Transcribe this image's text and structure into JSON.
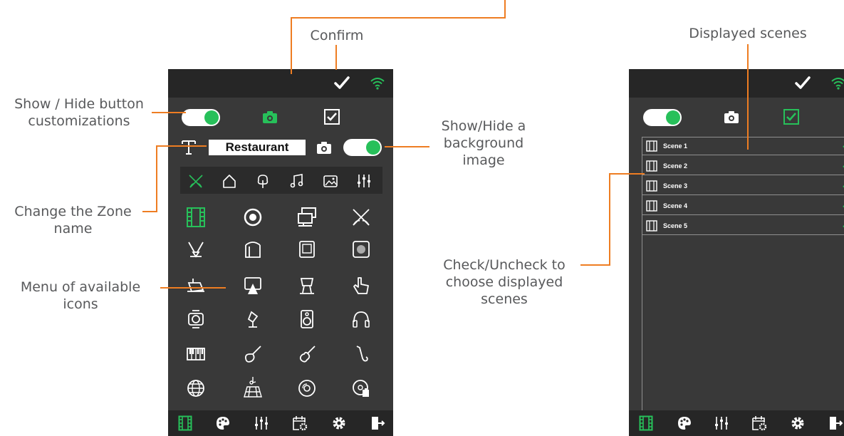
{
  "annotations": {
    "confirm": "Confirm",
    "show_hide_customizations": [
      "Show / Hide button",
      "customizations"
    ],
    "change_zone_name": [
      "Change the Zone",
      "name"
    ],
    "menu_icons": [
      "Menu of available",
      "icons"
    ],
    "show_hide_background": [
      "Show/Hide a",
      "background",
      "image"
    ],
    "displayed_scenes": "Displayed scenes",
    "check_uncheck": [
      "Check/Uncheck to",
      "choose displayed",
      "scenes"
    ]
  },
  "left_phone": {
    "zone_name": "Restaurant",
    "customizations_toggle_on": true,
    "background_toggle_on": true,
    "categories": [
      "tools-icon",
      "home-icon",
      "tree-icon",
      "music-icon",
      "photo-icon",
      "sliders-icon"
    ],
    "icon_grid": [
      [
        "film-icon",
        "target-icon",
        "screens-icon",
        "tools-icon"
      ],
      [
        "spotlights-icon",
        "cylinder-icon",
        "projector-screen-icon",
        "speaker-grille-icon"
      ],
      [
        "spot-lamp-icon",
        "projection-icon",
        "moving-head-icon",
        "hand-pointer-icon"
      ],
      [
        "fresnel-icon",
        "beacon-icon",
        "speaker-icon",
        "headphones-icon"
      ],
      [
        "piano-icon",
        "guitar-icon",
        "violin-icon",
        "saxophone-icon"
      ],
      [
        "globe-icon",
        "dance-floor-icon",
        "disc-icon",
        "disc-hand-icon"
      ]
    ],
    "nav": [
      "film-icon",
      "palette-icon",
      "sliders-icon",
      "calendar-gear-icon",
      "gear-icon",
      "exit-icon"
    ]
  },
  "right_phone": {
    "scenes": [
      {
        "label": "Scene 1",
        "checked": true
      },
      {
        "label": "Scene 2",
        "checked": true
      },
      {
        "label": "Scene 3",
        "checked": true
      },
      {
        "label": "Scene 4",
        "checked": true
      },
      {
        "label": "Scene 5",
        "checked": true
      }
    ],
    "nav": [
      "film-icon",
      "palette-icon",
      "sliders-icon",
      "calendar-gear-icon",
      "gear-icon",
      "exit-icon"
    ]
  },
  "colors": {
    "accent": "#27c05a",
    "callout_line": "#ee7d22",
    "callout_text": "#58595b",
    "phone_bg": "#393939",
    "bar_bg": "#262626"
  }
}
